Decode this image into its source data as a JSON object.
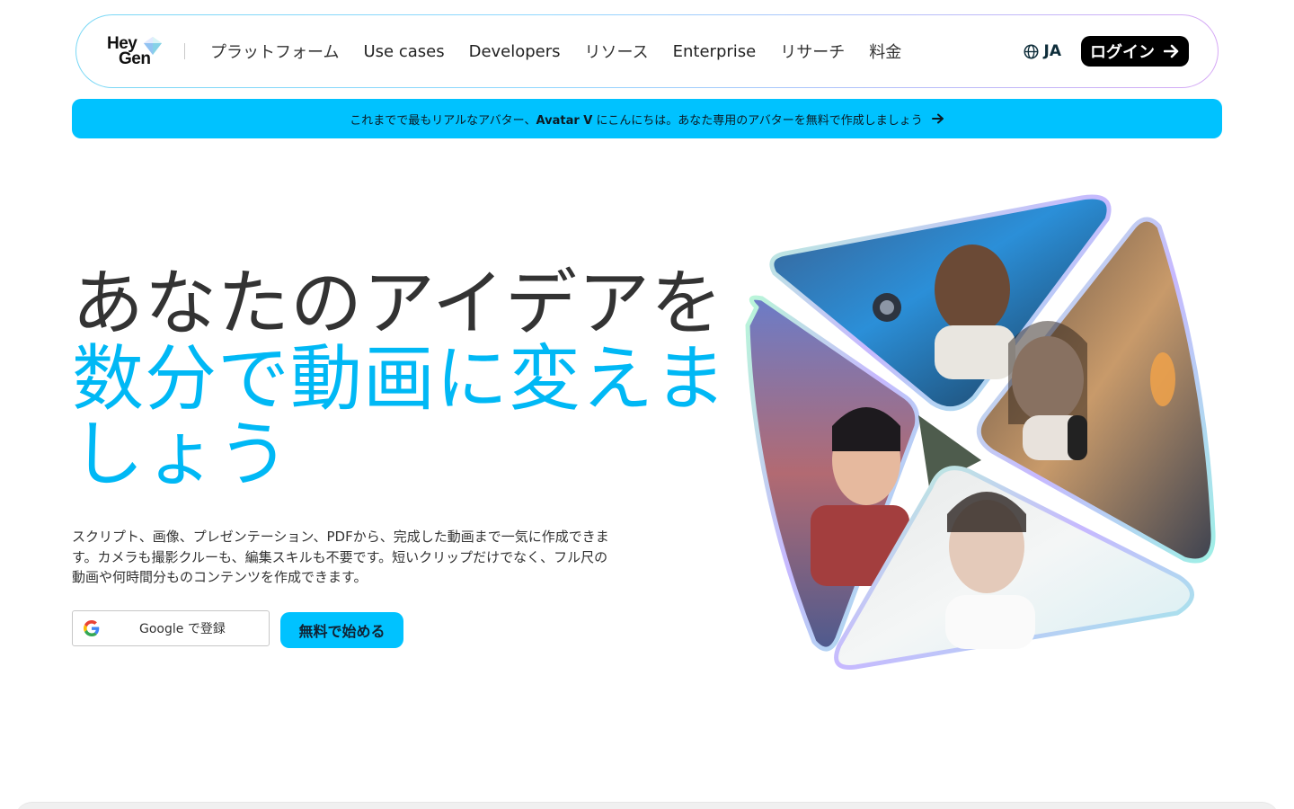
{
  "nav": {
    "logo_line1": "Hey",
    "logo_line2": "Gen",
    "links": [
      {
        "label": "プラットフォーム"
      },
      {
        "label": "Use cases"
      },
      {
        "label": "Developers"
      },
      {
        "label": "リソース"
      },
      {
        "label": "Enterprise"
      },
      {
        "label": "リサーチ"
      },
      {
        "label": "料金"
      }
    ],
    "language": "JA",
    "login_label": "ログイン"
  },
  "banner": {
    "text_before": "これまでで最もリアルなアバター、",
    "text_bold": "Avatar V",
    "text_after": " にこんにちは。あなた専用のアバターを無料で作成しましょう"
  },
  "hero": {
    "title_line1": "あなたのアイデアを",
    "title_line2": "数分で動画に変えましょう",
    "description": "スクリプト、画像、プレゼンテーション、PDFから、完成した動画まで一気に作成できます。カメラも撮影クルーも、編集スキルも不要です。短いクリップだけでなく、フル尺の動画や何時間分ものコンテンツを作成できます。",
    "google_button": "Google で登録",
    "start_button": "無料で始める"
  },
  "icons": {
    "logo": "heygen-gem-logo",
    "language": "globe-icon",
    "login_arrow": "arrow-right-icon",
    "banner_arrow": "arrow-right-icon",
    "google": "google-g-icon"
  },
  "colors": {
    "accent": "#00c2ff",
    "title_accent": "#00b8f5",
    "text_dark": "#333333",
    "login_bg": "#000000"
  }
}
